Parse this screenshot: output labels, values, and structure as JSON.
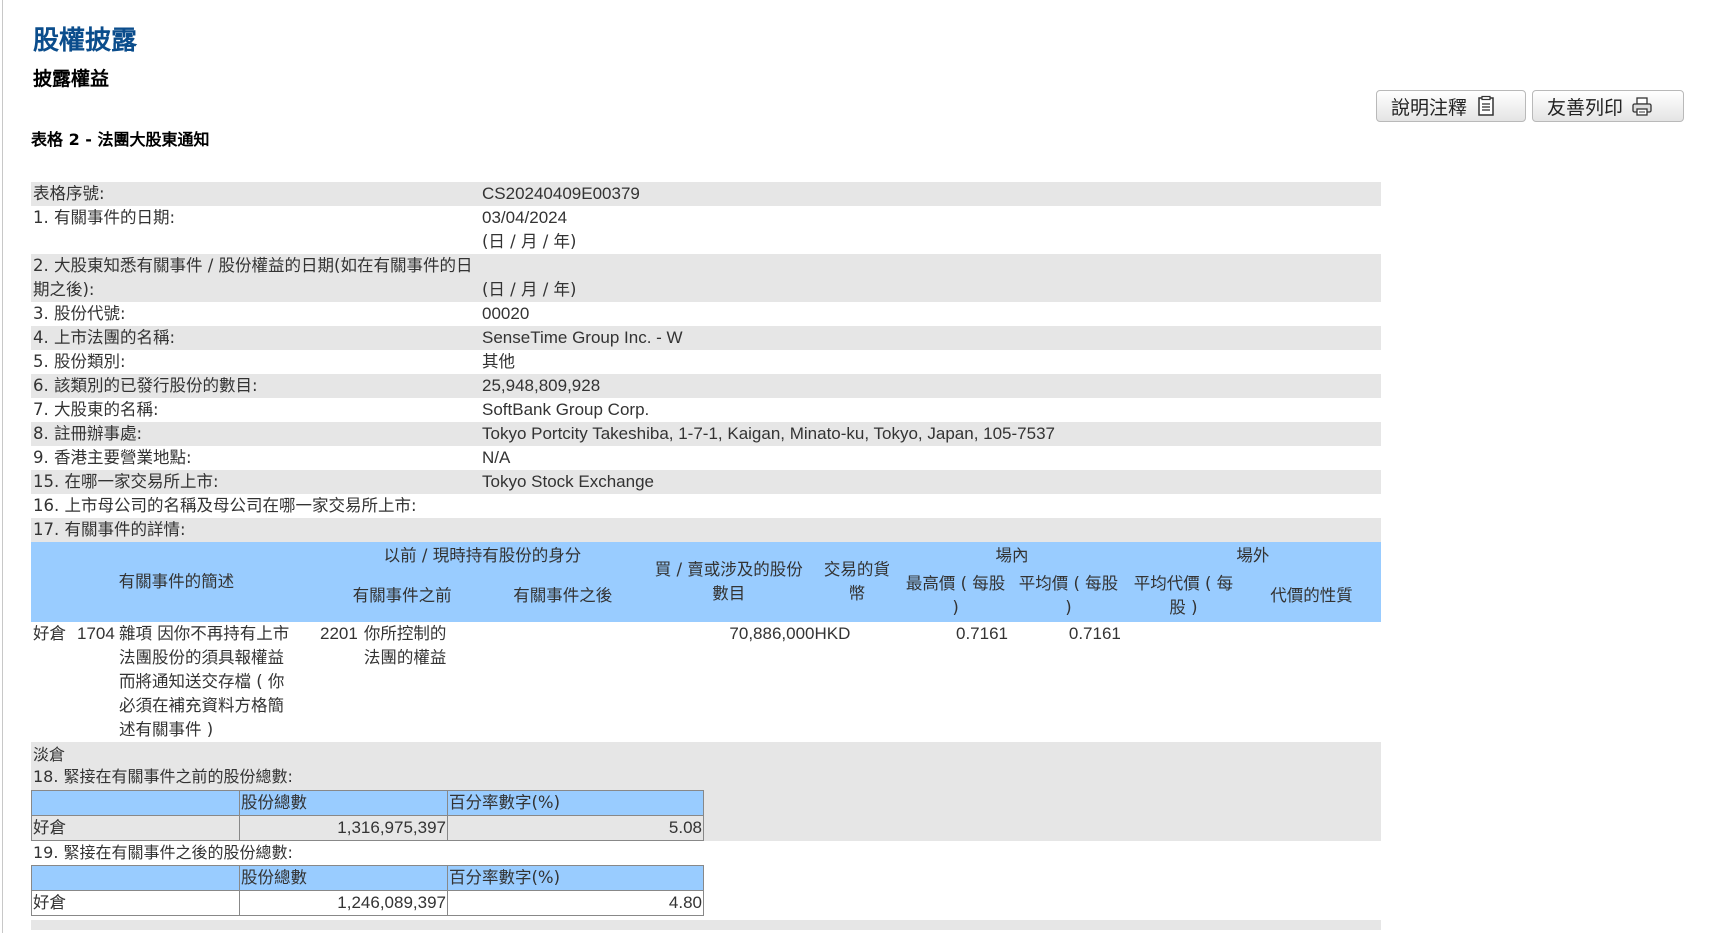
{
  "header": {
    "page_title": "股權披露",
    "section_title": "披露權益",
    "form_title": "表格 2 - 法團大股東通知",
    "help_button": "說明注釋",
    "print_button": "友善列印"
  },
  "fields": [
    {
      "label": "表格序號:",
      "value": "CS20240409E00379",
      "value2": ""
    },
    {
      "label": "1. 有關事件的日期:",
      "value": "03/04/2024",
      "value2": "(日 / 月 / 年)"
    },
    {
      "label": "2. 大股東知悉有關事件 / 股份權益的日期(如在有關事件的日期之後):",
      "value": "",
      "value2": "(日 / 月 / 年)"
    },
    {
      "label": "3. 股份代號:",
      "value": "00020",
      "value2": ""
    },
    {
      "label": "4. 上市法團的名稱:",
      "value": "SenseTime Group Inc. - W",
      "value2": ""
    },
    {
      "label": "5. 股份類別:",
      "value": "其他",
      "value2": ""
    },
    {
      "label": "6. 該類別的已發行股份的數目:",
      "value": "25,948,809,928",
      "value2": ""
    },
    {
      "label": "7. 大股東的名稱:",
      "value": "SoftBank Group Corp.",
      "value2": ""
    },
    {
      "label": "8. 註冊辦事處:",
      "value": "Tokyo Portcity Takeshiba, 1-7-1, Kaigan, Minato-ku, Tokyo, Japan, 105-7537",
      "value2": ""
    },
    {
      "label": "9. 香港主要營業地點:",
      "value": "N/A",
      "value2": ""
    },
    {
      "label": "15. 在哪一家交易所上市:",
      "value": "Tokyo Stock Exchange",
      "value2": ""
    },
    {
      "label": "16. 上市母公司的名稱及母公司在哪一家交易所上市:",
      "value": "",
      "value2": ""
    },
    {
      "label": "17. 有關事件的詳情:",
      "value": "",
      "value2": ""
    }
  ],
  "event_table": {
    "h_desc": "有關事件的簡述",
    "h_capacity": "以前 / 現時持有股份的身分",
    "h_before": "有關事件之前",
    "h_after": "有關事件之後",
    "h_shares": "買 / 賣或涉及的股份數目",
    "h_currency": "交易的貨幣",
    "h_onex": "場內",
    "h_offex": "場外",
    "h_high": "最高價 ( 每股 )",
    "h_avg": "平均價 ( 每股 )",
    "h_avgcons": "平均代價 ( 每股 )",
    "h_nature": "代價的性質",
    "row": {
      "position": "好倉",
      "code": "1704",
      "desc": "雜項 因你不再持有上市法團股份的須具報權益而將通知送交存檔 ( 你必須在補充資料方格簡述有關事件 )",
      "cap_code": "2201",
      "cap_before": "你所控制的法團的權益",
      "cap_after": "",
      "shares": "70,886,000",
      "currency": "HKD",
      "high": "0.7161",
      "avg": "0.7161",
      "avgcons": "",
      "nature": ""
    },
    "short_label": "淡倉"
  },
  "q18": {
    "label": "18. 緊接在有關事件之前的股份總數:",
    "h_shares": "股份總數",
    "h_pct": "百分率數字(%)",
    "row_label": "好倉",
    "shares": "1,316,975,397",
    "pct": "5.08"
  },
  "q19": {
    "label": "19. 緊接在有關事件之後的股份總數:",
    "h_shares": "股份總數",
    "h_pct": "百分率數字(%)",
    "row_label": "好倉",
    "shares": "1,246,089,397",
    "pct": "4.80"
  }
}
